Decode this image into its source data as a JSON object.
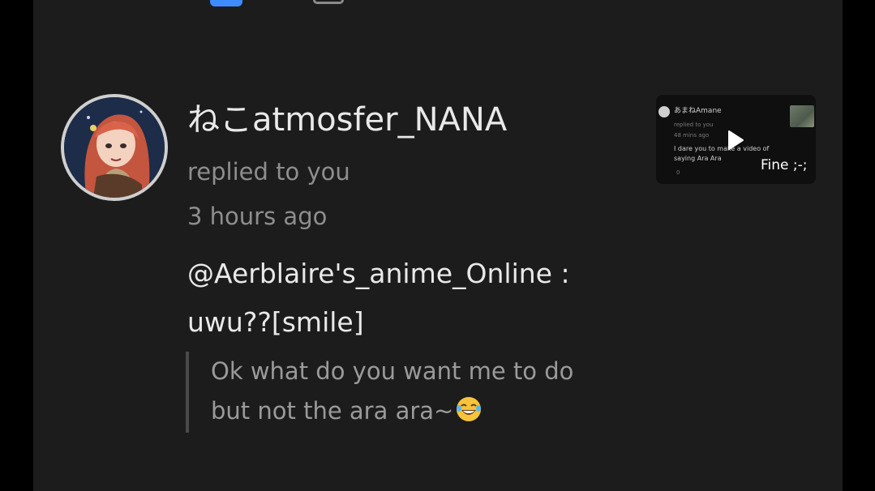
{
  "comment": {
    "username": "ねこatmosfer_NANA",
    "action": "replied to you",
    "timestamp": "3 hours ago",
    "reply_line1": "@Aerblaire's_anime_Online :",
    "reply_line2": "uwu??[smile]",
    "quote_line1": "Ok what do you want me to do",
    "quote_line2": "but not the ara ara~",
    "quote_emoji": "face-with-tears-of-joy-emoji"
  },
  "thumbnail": {
    "name": "あまねAmane",
    "action": "replied to you",
    "time": "48 mins ago",
    "text": "I dare you to make a video of saying Ara Ara",
    "count": "0",
    "caption": "Fine ;-;",
    "play_icon": "play-icon"
  },
  "colors": {
    "background": "#1c1c1c",
    "primary_text": "#e9e9e9",
    "secondary_text": "#8e8e8e",
    "accent": "#3d8bff"
  }
}
